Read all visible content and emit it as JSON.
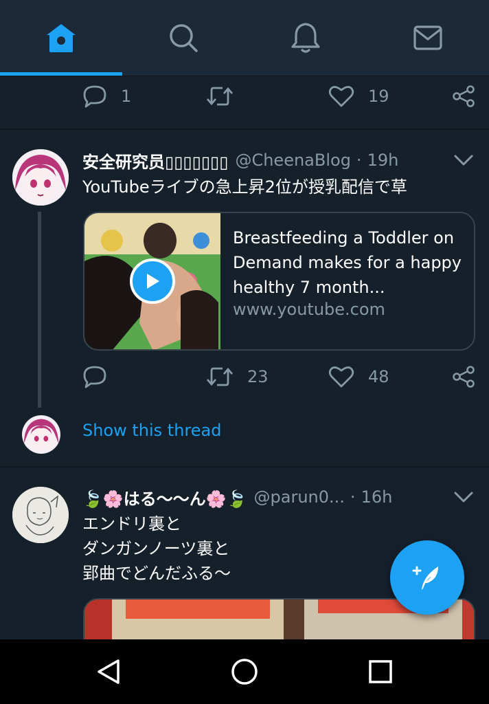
{
  "colors": {
    "background": "#15202b",
    "topbar": "#1c2938",
    "accent": "#1da1f2",
    "muted": "#8899a6",
    "border": "#38444d"
  },
  "tabs": [
    {
      "name": "home",
      "icon": "home-icon",
      "active": true
    },
    {
      "name": "search",
      "icon": "search-icon",
      "active": false
    },
    {
      "name": "notifications",
      "icon": "bell-icon",
      "active": false
    },
    {
      "name": "messages",
      "icon": "mail-icon",
      "active": false
    }
  ],
  "prev_tweet": {
    "reply_count": "1",
    "retweet_count": "",
    "like_count": "19"
  },
  "tweet1": {
    "name": "安全研究员▯▯▯▯▯▯▯",
    "handle": "@CheenaBlog",
    "separator": "·",
    "time": "19h",
    "text": "YouTubeライブの急上昇2位が授乳配信で草",
    "card": {
      "title_line1": "Breastfeeding a Toddler on",
      "title_line2": "Demand makes for a happy",
      "title_line3": "healthy 7 month...",
      "url": "www.youtube.com"
    },
    "reply_count": "",
    "retweet_count": "23",
    "like_count": "48",
    "show_thread": "Show this thread"
  },
  "tweet2": {
    "name": "🍃🌸はる〜〜ん🌸🍃",
    "handle": "@parun0...",
    "separator": "·",
    "time": "16h",
    "text_line1": "エンドリ裏と",
    "text_line2": "ダンガンノーツ裏と",
    "text_line3": "郢曲でどんだふる〜"
  },
  "fab": {
    "icon": "compose-tweet-icon"
  },
  "navbar": [
    {
      "name": "back",
      "icon": "back-triangle-icon"
    },
    {
      "name": "home",
      "icon": "home-circle-icon"
    },
    {
      "name": "recents",
      "icon": "recents-square-icon"
    }
  ]
}
